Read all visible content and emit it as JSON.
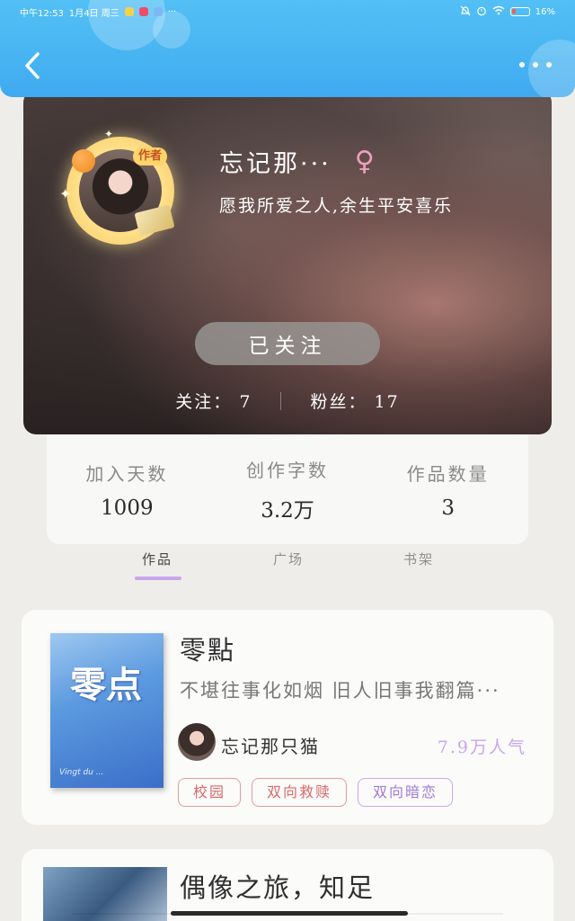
{
  "status_bar": {
    "time": "中午12:53",
    "date": "1月4日 周三",
    "more": "···",
    "battery": "16%"
  },
  "header": {
    "back_icon": "chevron-left-icon",
    "more_icon": "more-dots-icon"
  },
  "profile": {
    "author_badge": "作者",
    "nickname": "忘记那···",
    "gender_icon": "♀",
    "signature": "愿我所爱之人,余生平安喜乐",
    "follow_button": "已关注",
    "following_label": "关注：",
    "following_count": "7",
    "fans_label": "粉丝：",
    "fans_count": "17"
  },
  "info": [
    {
      "label": "加入天数",
      "value": "1009"
    },
    {
      "label": "创作字数",
      "value": "3.2万"
    },
    {
      "label": "作品数量",
      "value": "3"
    }
  ],
  "tabs": [
    {
      "label": "作品",
      "active": true
    },
    {
      "label": "广场",
      "active": false
    },
    {
      "label": "书架",
      "active": false
    }
  ],
  "works": [
    {
      "cover_title": "零点",
      "cover_sub": "Vingt du ...",
      "title": "零點",
      "description": "不堪往事化如烟 旧人旧事我翻篇···",
      "author": "忘记那只猫",
      "readers": "7.9万人气",
      "tags": [
        {
          "label": "校园",
          "color": "#d86a6a"
        },
        {
          "label": "双向救赎",
          "color": "#d86a6a"
        },
        {
          "label": "双向暗恋",
          "color": "#a07ad8"
        }
      ]
    },
    {
      "title": "偶像之旅，知足"
    }
  ],
  "colors": {
    "header_blue": "#47b4f2",
    "accent_purple": "#c7a6ea",
    "tag_red": "#d86a6a"
  }
}
